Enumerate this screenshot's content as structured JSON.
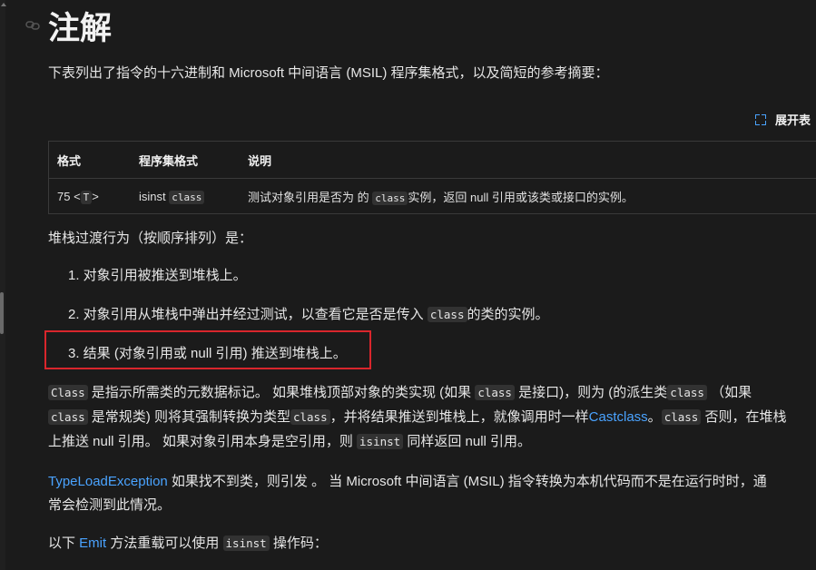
{
  "heading": "注解",
  "intro": "下表列出了指令的十六进制和 Microsoft 中间语言 (MSIL) 程序集格式，以及简短的参考摘要：",
  "expand_label": "展开表",
  "table": {
    "headers": [
      "格式",
      "程序集格式",
      "说明"
    ],
    "row": {
      "format_prefix": "75 <",
      "format_code": "T",
      "format_suffix": ">",
      "assembly_text": "isinst",
      "assembly_code": "class",
      "desc_a": "测试对象引用是否为 的",
      "desc_code": "class",
      "desc_b": "实例，返回 null 引用或该类或接口的实例。"
    }
  },
  "stack_intro": "堆栈过渡行为（按顺序排列）是：",
  "list": {
    "item1": "1. 对象引用被推送到堆栈上。",
    "item2_a": "2. 对象引用从堆栈中弹出并经过测试，以查看它是否是传入",
    "item2_code": "class",
    "item2_b": "的类的实例。",
    "item3": "3. 结果 (对象引用或 null 引用) 推送到堆栈上。"
  },
  "para1": {
    "c1": "Class",
    "t1": " 是指示所需类的元数据标记。 如果堆栈顶部对象的类实现 (如果",
    "c2": "class",
    "t2": " 是接口)，则为 (的派生类",
    "c3": "class",
    "t3": "（如果",
    "c4": "class",
    "t4": " 是常规类) 则将其强制转换为类型",
    "c5": "class",
    "t5": "，并将结果推送到堆栈上，就像调用时一样",
    "link1": "Castclass",
    "t6": "。",
    "c6": "class",
    "t7": " 否则，在堆栈",
    "t8": "上推送 null 引用。 如果对象引用本身是空引用，则",
    "c7": "isinst",
    "t9": " 同样返回 null 引用。"
  },
  "para2": {
    "link": "TypeLoadException",
    "t1": " 如果找不到类，则引发 。 当 Microsoft 中间语言 (MSIL) 指令转换为本机代码而不是在运行时时，通",
    "t2": "常会检测到此情况。"
  },
  "para3": {
    "t1": "以下 ",
    "link": "Emit",
    "t2": " 方法重载可以使用",
    "code": "isinst",
    "t3": " 操作码："
  },
  "colors": {
    "background": "#1b1b1b",
    "link": "#4aa3ff",
    "highlight_border": "#d9262c",
    "code_bg": "#323232"
  },
  "icons": [
    "link-icon",
    "expand-icon"
  ]
}
